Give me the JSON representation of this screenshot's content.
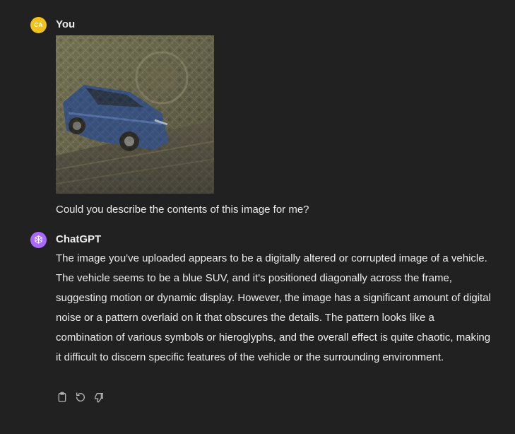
{
  "conversation": {
    "user": {
      "avatar_initials": "CA",
      "author": "You",
      "attachment_alt": "digitally altered image of a blue SUV",
      "text": "Could you describe the contents of this image for me?"
    },
    "assistant": {
      "author": "ChatGPT",
      "avatar_icon": "openai-logo-icon",
      "text": "The image you've uploaded appears to be a digitally altered or corrupted image of a vehicle. The vehicle seems to be a blue SUV, and it's positioned diagonally across the frame, suggesting motion or dynamic display. However, the image has a significant amount of digital noise or a pattern overlaid on it that obscures the details. The pattern looks like a combination of various symbols or hieroglyphs, and the overall effect is quite chaotic, making it difficult to discern specific features of the vehicle or the surrounding environment.",
      "actions": [
        {
          "icon": "clipboard-icon",
          "name": "copy"
        },
        {
          "icon": "regenerate-icon",
          "name": "regenerate"
        },
        {
          "icon": "thumbs-down-icon",
          "name": "bad-response"
        }
      ]
    }
  },
  "colors": {
    "background": "#212121",
    "text": "#ececec",
    "user_avatar": "#f0c21b",
    "assistant_avatar": "#ab68ff",
    "icon": "#b4b4b4"
  }
}
